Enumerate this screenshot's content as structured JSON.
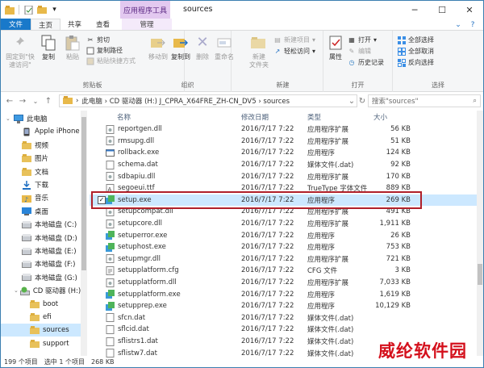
{
  "window": {
    "context_tab": "应用程序工具",
    "title": "sources",
    "colors": {
      "file_tab": "#1979ca",
      "context_tab": "#e3c9f0",
      "selection": "#cce8ff",
      "highlight_box": "#b0202a"
    }
  },
  "tabs": [
    {
      "label": "文件"
    },
    {
      "label": "主页"
    },
    {
      "label": "共享"
    },
    {
      "label": "查看"
    },
    {
      "label": "管理"
    }
  ],
  "ribbon": {
    "pin": "固定到\"快\n速访问\"",
    "copy": "复制",
    "paste": "粘贴",
    "cut": "剪切",
    "copy_path": "复制路径",
    "paste_shortcut": "粘贴快捷方式",
    "clipboard": "剪贴板",
    "move_to": "移动到",
    "copy_to": "复制到",
    "delete": "删除",
    "rename": "重命名",
    "organize": "组织",
    "new_folder": "新建\n文件夹",
    "new_item": "新建项目",
    "easy_access": "轻松访问",
    "new": "新建",
    "properties": "属性",
    "open": "打开",
    "edit": "编辑",
    "history": "历史记录",
    "open_group": "打开",
    "select_all": "全部选择",
    "select_none": "全部取消",
    "invert": "反向选择",
    "select": "选择"
  },
  "address": {
    "path": "此电脑 › CD 驱动器 (H:) J_CPRA_X64FRE_ZH-CN_DV5 › sources",
    "search_placeholder": "搜索\"sources\""
  },
  "nav": [
    {
      "label": "此电脑",
      "icon": "computer-icon"
    },
    {
      "label": "Apple iPhone",
      "icon": "phone-icon"
    },
    {
      "label": "视频",
      "icon": "video-folder-icon"
    },
    {
      "label": "图片",
      "icon": "pictures-folder-icon"
    },
    {
      "label": "文档",
      "icon": "documents-folder-icon"
    },
    {
      "label": "下载",
      "icon": "download-folder-icon"
    },
    {
      "label": "音乐",
      "icon": "music-folder-icon"
    },
    {
      "label": "桌面",
      "icon": "desktop-folder-icon"
    },
    {
      "label": "本地磁盘 (C:)",
      "icon": "drive-icon"
    },
    {
      "label": "本地磁盘 (D:)",
      "icon": "drive-icon"
    },
    {
      "label": "本地磁盘 (E:)",
      "icon": "drive-icon"
    },
    {
      "label": "本地磁盘 (F:)",
      "icon": "drive-icon"
    },
    {
      "label": "本地磁盘 (G:)",
      "icon": "drive-icon"
    },
    {
      "label": "CD 驱动器 (H:)",
      "icon": "cd-drive-icon"
    },
    {
      "label": "boot",
      "icon": "folder-icon"
    },
    {
      "label": "efi",
      "icon": "folder-icon"
    },
    {
      "label": "sources",
      "icon": "folder-icon"
    },
    {
      "label": "support",
      "icon": "folder-icon"
    }
  ],
  "columns": {
    "name": "名称",
    "date": "修改日期",
    "type": "类型",
    "size": "大小"
  },
  "files": [
    {
      "name": "reportgen.dll",
      "date": "2016/7/17 7:22",
      "type": "应用程序扩展",
      "size": "56 KB",
      "icon": "dll"
    },
    {
      "name": "rmsupg.dll",
      "date": "2016/7/17 7:22",
      "type": "应用程序扩展",
      "size": "51 KB",
      "icon": "dll"
    },
    {
      "name": "rollback.exe",
      "date": "2016/7/17 7:22",
      "type": "应用程序",
      "size": "124 KB",
      "icon": "exe"
    },
    {
      "name": "schema.dat",
      "date": "2016/7/17 7:22",
      "type": "媒体文件(.dat)",
      "size": "92 KB",
      "icon": "dat"
    },
    {
      "name": "sdbapiu.dll",
      "date": "2016/7/17 7:22",
      "type": "应用程序扩展",
      "size": "170 KB",
      "icon": "dll"
    },
    {
      "name": "segoeui.ttf",
      "date": "2016/7/17 7:22",
      "type": "TrueType 字体文件",
      "size": "889 KB",
      "icon": "ttf"
    },
    {
      "name": "setup.exe",
      "date": "2016/7/17 7:22",
      "type": "应用程序",
      "size": "269 KB",
      "icon": "setup",
      "selected": true
    },
    {
      "name": "setupcompat.dll",
      "date": "2016/7/17 7:22",
      "type": "应用程序扩展",
      "size": "491 KB",
      "icon": "dll"
    },
    {
      "name": "setupcore.dll",
      "date": "2016/7/17 7:22",
      "type": "应用程序扩展",
      "size": "1,911 KB",
      "icon": "dll"
    },
    {
      "name": "setuperror.exe",
      "date": "2016/7/17 7:22",
      "type": "应用程序",
      "size": "26 KB",
      "icon": "setup"
    },
    {
      "name": "setuphost.exe",
      "date": "2016/7/17 7:22",
      "type": "应用程序",
      "size": "753 KB",
      "icon": "setup"
    },
    {
      "name": "setupmgr.dll",
      "date": "2016/7/17 7:22",
      "type": "应用程序扩展",
      "size": "721 KB",
      "icon": "dll"
    },
    {
      "name": "setupplatform.cfg",
      "date": "2016/7/17 7:22",
      "type": "CFG 文件",
      "size": "3 KB",
      "icon": "cfg"
    },
    {
      "name": "setupplatform.dll",
      "date": "2016/7/17 7:22",
      "type": "应用程序扩展",
      "size": "7,033 KB",
      "icon": "dll"
    },
    {
      "name": "setupplatform.exe",
      "date": "2016/7/17 7:22",
      "type": "应用程序",
      "size": "1,619 KB",
      "icon": "setup"
    },
    {
      "name": "setupprep.exe",
      "date": "2016/7/17 7:22",
      "type": "应用程序",
      "size": "10,129 KB",
      "icon": "setup"
    },
    {
      "name": "sfcn.dat",
      "date": "2016/7/17 7:22",
      "type": "媒体文件(.dat)",
      "size": "",
      "icon": "dat"
    },
    {
      "name": "sflcid.dat",
      "date": "2016/7/17 7:22",
      "type": "媒体文件(.dat)",
      "size": "",
      "icon": "dat"
    },
    {
      "name": "sflistrs1.dat",
      "date": "2016/7/17 7:22",
      "type": "媒体文件(.dat)",
      "size": "",
      "icon": "dat"
    },
    {
      "name": "sflistw7.dat",
      "date": "2016/7/17 7:22",
      "type": "媒体文件(.dat)",
      "size": "",
      "icon": "dat"
    }
  ],
  "status": {
    "count": "199 个项目",
    "selected": "选中 1 个项目",
    "size": "268 KB"
  },
  "watermark": "威纶软件园"
}
